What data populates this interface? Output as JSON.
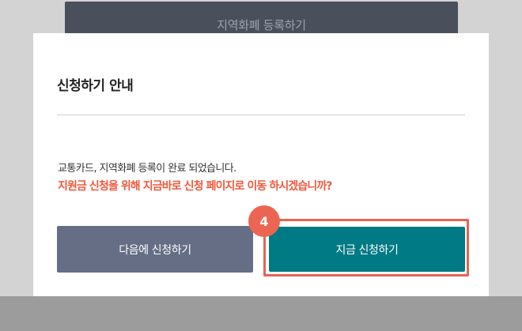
{
  "background": {
    "register_button_label": "지역화폐 등록하기"
  },
  "modal": {
    "title": "신청하기 안내",
    "message": "교통카드, 지역화폐 등록이 완료 되었습니다.",
    "question": "지원금 신청을 위해 지금바로 신청 페이지로 이동 하시겠습니까?",
    "later_button_label": "다음에 신청하기",
    "apply_now_button_label": "지금 신청하기"
  },
  "annotation": {
    "step_number": "4"
  },
  "colors": {
    "accent": "#007a84",
    "secondary_button": "#666e85",
    "question_text": "#f0583b",
    "highlight": "#e56452"
  }
}
